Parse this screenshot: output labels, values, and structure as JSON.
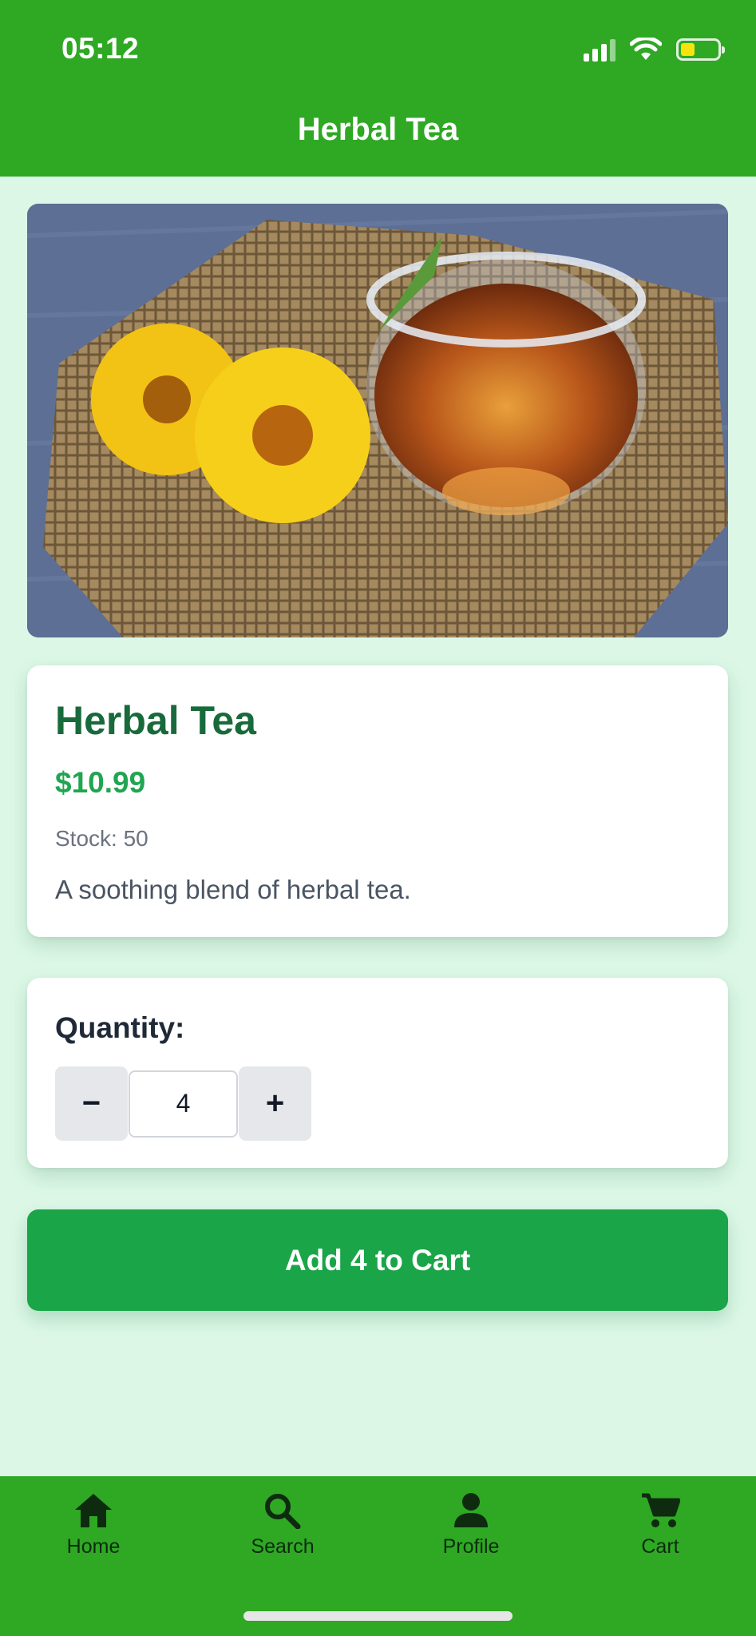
{
  "status_bar": {
    "time": "05:12"
  },
  "header": {
    "title": "Herbal Tea"
  },
  "product": {
    "name": "Herbal Tea",
    "price": "$10.99",
    "stock": "Stock: 50",
    "description": "A soothing blend of herbal tea."
  },
  "quantity": {
    "label": "Quantity:",
    "decrement": "−",
    "value": "4",
    "increment": "+"
  },
  "add_to_cart": {
    "label": "Add 4 to Cart"
  },
  "bottom_nav": {
    "items": [
      {
        "label": "Home",
        "icon": "home-icon"
      },
      {
        "label": "Search",
        "icon": "search-icon"
      },
      {
        "label": "Profile",
        "icon": "person-icon"
      },
      {
        "label": "Cart",
        "icon": "cart-icon"
      }
    ]
  },
  "colors": {
    "header_bg": "#2fa824",
    "page_bg": "#dcf7e6",
    "accent_green": "#1aa548",
    "title_green": "#186a3b",
    "price_green": "#20a551"
  }
}
